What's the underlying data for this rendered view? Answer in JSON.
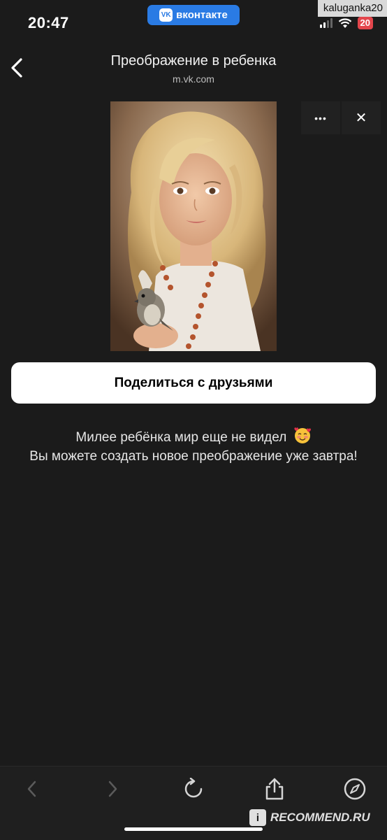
{
  "status_bar": {
    "time": "20:47",
    "app_badge": "вконтакте",
    "app_badge_logo": "VK",
    "username": "kaluganka20",
    "battery": "20"
  },
  "header": {
    "title": "Преображение в ребенка",
    "url": "m.vk.com"
  },
  "overlay": {
    "more_icon": "•••",
    "close_icon": "✕"
  },
  "share_button": {
    "label": "Поделиться с друзьями"
  },
  "message": {
    "line1": "Милее ребёнка мир еще не видел",
    "line2": "Вы можете создать новое преображение уже завтра!"
  },
  "toolbar": {
    "icons": [
      "back-icon",
      "forward-icon",
      "reload-icon",
      "share-icon",
      "compass-icon"
    ]
  },
  "watermark": {
    "text": "RECOMMEND.RU",
    "badge": "i"
  },
  "colors": {
    "background": "#1b1b1b",
    "accent": "#2a7be4",
    "battery": "#e3464c"
  }
}
